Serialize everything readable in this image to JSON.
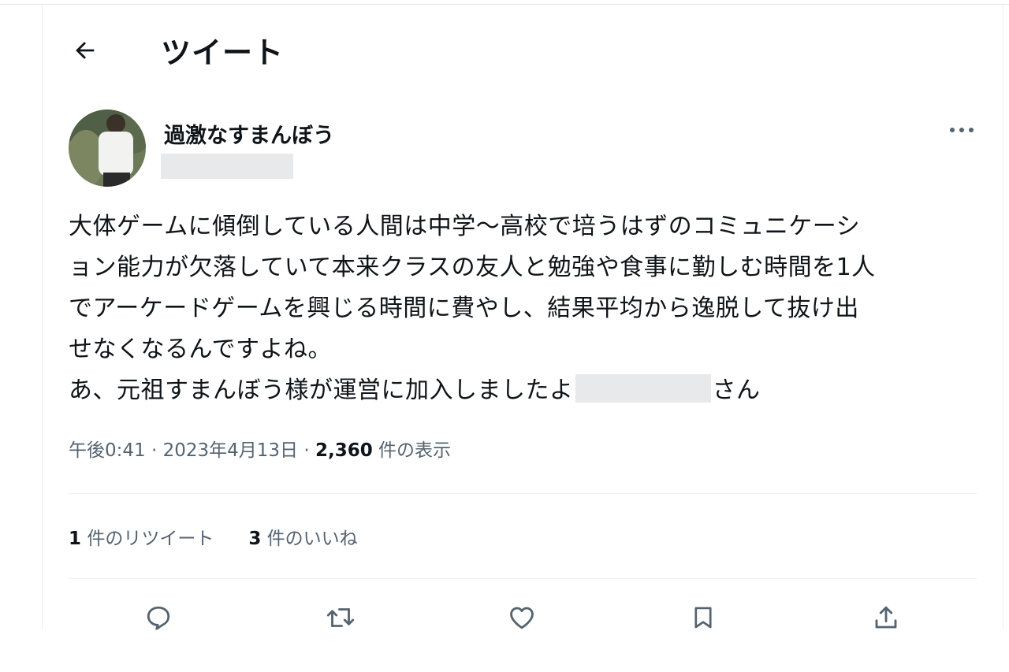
{
  "header": {
    "back_icon": "arrow-left-icon",
    "title": "ツイート"
  },
  "tweet": {
    "author": {
      "display_name": "過激なすまんぼう",
      "more_icon": "ellipsis-icon"
    },
    "text_lines": [
      "大体ゲームに傾倒している人間は中学〜高校で培うはずのコミュニケーシ",
      "ョン能力が欠落していて本来クラスの友人と勉強や食事に勤しむ時間を1人",
      "でアーケードゲームを興じる時間に費やし、結果平均から逸脱して抜け出",
      "せなくなるんですよね。"
    ],
    "last_line": {
      "before": "あ、元祖すまんぼう様が運営に加入しましたよ",
      "after": "さん"
    },
    "meta": {
      "time": "午後0:41",
      "sep1": " · ",
      "date": "2023年4月13日",
      "sep2": " · ",
      "views_count": "2,360",
      "views_label": " 件の表示"
    },
    "stats": {
      "retweets_count": "1",
      "retweets_label": " 件のリツイート",
      "likes_count": "3",
      "likes_label": " 件のいいね"
    },
    "actions": [
      "reply-icon",
      "retweet-icon",
      "like-icon",
      "bookmark-icon",
      "share-icon"
    ]
  },
  "colors": {
    "text": "#0f1419",
    "secondary": "#536471",
    "divider": "#eff1f3",
    "redaction": "#e8e9eb"
  }
}
